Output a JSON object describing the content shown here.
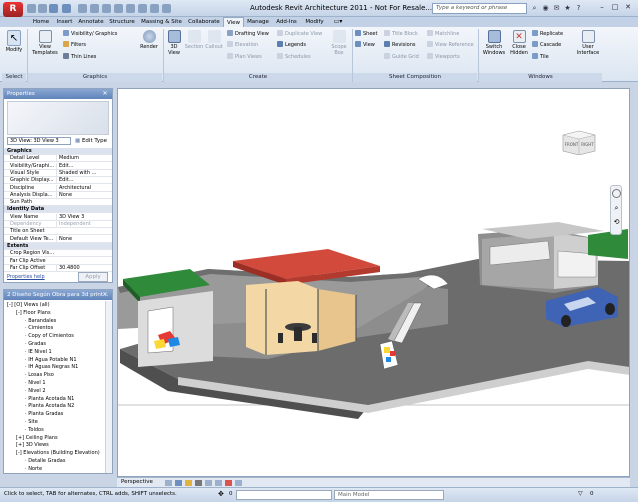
{
  "app": {
    "title": "Autodesk Revit Architecture 2011 - Not For Resale...",
    "logo_letter": "R",
    "search_placeholder": "Type a keyword or phrase"
  },
  "tabs": [
    "Home",
    "Insert",
    "Annotate",
    "Structure",
    "Massing & Site",
    "Collaborate",
    "View",
    "Manage",
    "Add-Ins",
    "Modify"
  ],
  "active_tab": "View",
  "ribbon": {
    "select": {
      "modify": "Modify",
      "group": "Select"
    },
    "graphics": {
      "view_templates": "View Templates",
      "visibility": "Visibility/ Graphics",
      "filters": "Filters",
      "thin_lines": "Thin Lines",
      "render": "Render",
      "group": "Graphics"
    },
    "create": {
      "3d_view": "3D View",
      "section": "Section",
      "callout": "Callout",
      "drafting_view": "Drafting View",
      "elevation": "Elevation",
      "plan_views": "Plan Views",
      "duplicate_view": "Duplicate View",
      "legends": "Legends",
      "schedules": "Schedules",
      "scope_box": "Scope Box",
      "group": "Create"
    },
    "sheet_composition": {
      "sheet": "Sheet",
      "view": "View",
      "title_block": "Title Block",
      "revisions": "Revisions",
      "guide_grid": "Guide Grid",
      "matchline": "Matchline",
      "view_reference": "View Reference",
      "viewports": "Viewports",
      "group": "Sheet Composition"
    },
    "windows": {
      "switch_windows": "Switch Windows",
      "close_hidden": "Close Hidden",
      "replicate": "Replicate",
      "cascade": "Cascade",
      "tile": "Tile",
      "user_interface": "User Interface",
      "group": "Windows"
    }
  },
  "properties": {
    "title": "Properties",
    "view_selector": "3D View: 3D View 3",
    "edit_type": "Edit Type",
    "rows": [
      {
        "section": "Graphics"
      },
      {
        "k": "Detail Level",
        "v": "Medium"
      },
      {
        "k": "Visibility/Graphi...",
        "v": "Edit..."
      },
      {
        "k": "Visual Style",
        "v": "Shaded with ..."
      },
      {
        "k": "Graphic Display...",
        "v": "Edit..."
      },
      {
        "k": "Discipline",
        "v": "Architectural"
      },
      {
        "k": "Analysis Displa...",
        "v": "None"
      },
      {
        "k": "Sun Path",
        "v": ""
      },
      {
        "section": "Identity Data"
      },
      {
        "k": "View Name",
        "v": "3D View 3"
      },
      {
        "k": "Dependency",
        "v": "Independent",
        "dim": true
      },
      {
        "k": "Title on Sheet",
        "v": ""
      },
      {
        "k": "Default View Te...",
        "v": "None"
      },
      {
        "section": "Extents"
      },
      {
        "k": "Crop Region Vis...",
        "v": ""
      },
      {
        "k": "Far Clip Active",
        "v": ""
      },
      {
        "k": "Far Clip Offset",
        "v": "30.4800"
      }
    ],
    "help": "Properties help",
    "apply": "Apply"
  },
  "browser": {
    "title": "2 Diseño Según Obra para 3d print...",
    "items": [
      {
        "t": "[O] Views (all)",
        "lvl": 0,
        "exp": "-"
      },
      {
        "t": "Floor Plans",
        "lvl": 1,
        "exp": "-"
      },
      {
        "t": "Barandales",
        "lvl": 2
      },
      {
        "t": "Cimientos",
        "lvl": 2
      },
      {
        "t": "Copy of Cimientos",
        "lvl": 2
      },
      {
        "t": "Gradas",
        "lvl": 2
      },
      {
        "t": "IE Nivel 1",
        "lvl": 2
      },
      {
        "t": "IH Agua Potable N1",
        "lvl": 2
      },
      {
        "t": "IH Aguas Negras N1",
        "lvl": 2
      },
      {
        "t": "Losas Piso",
        "lvl": 2
      },
      {
        "t": "Nivel 1",
        "lvl": 2
      },
      {
        "t": "Nivel 2",
        "lvl": 2
      },
      {
        "t": "Planta Acotada N1",
        "lvl": 2
      },
      {
        "t": "Planta Acotada N2",
        "lvl": 2
      },
      {
        "t": "Planta Gradas",
        "lvl": 2
      },
      {
        "t": "Site",
        "lvl": 2
      },
      {
        "t": "Toldos",
        "lvl": 2
      },
      {
        "t": "Ceiling Plans",
        "lvl": 1,
        "exp": "+"
      },
      {
        "t": "3D Views",
        "lvl": 1,
        "exp": "+"
      },
      {
        "t": "Elevations (Building Elevation)",
        "lvl": 1,
        "exp": "-"
      },
      {
        "t": "Detalle Gradas",
        "lvl": 2
      },
      {
        "t": "Norte",
        "lvl": 2
      }
    ]
  },
  "viewcube": {
    "front": "FRONT",
    "right": "RIGHT"
  },
  "view_control": {
    "scale": "Perspective"
  },
  "status": {
    "hint": "Click to select, TAB for alternates, CTRL adds, SHIFT unselects.",
    "press_drag": "0",
    "model": "Main Model"
  }
}
